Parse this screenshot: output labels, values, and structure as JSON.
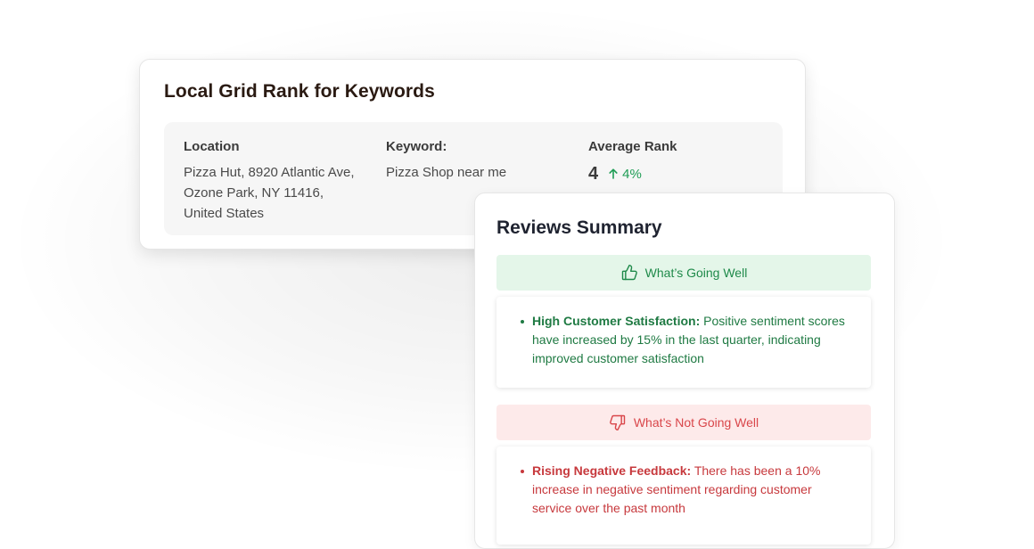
{
  "grid_rank": {
    "title": "Local Grid Rank for Keywords",
    "location_label": "Location",
    "location_lines": [
      "Pizza Hut, 8920 Atlantic Ave,",
      "Ozone Park, NY 11416,",
      "United States"
    ],
    "keyword_label": "Keyword:",
    "keyword_value": "Pizza Shop near me",
    "avg_rank_label": "Average Rank",
    "avg_rank_value": "4",
    "avg_rank_change": "4%",
    "change_icon": "arrow-up-icon",
    "change_color": "#1f9d55"
  },
  "reviews": {
    "title": "Reviews Summary",
    "going_well": {
      "label": "What’s Going Well",
      "icon": "thumbs-up-icon",
      "color": "#1f8a4a",
      "background": "#e4f6e9",
      "item_title": "High Customer Satisfaction:",
      "item_text": "Positive sentiment scores have increased by 15% in the last quarter, indicating improved customer satisfaction"
    },
    "not_going_well": {
      "label": "What’s Not Going Well",
      "icon": "thumbs-down-icon",
      "color": "#d9464a",
      "background": "#fdeaea",
      "item_title": "Rising Negative Feedback:",
      "item_text": "There has been a 10% increase in negative sentiment regarding customer service over the past month"
    }
  }
}
